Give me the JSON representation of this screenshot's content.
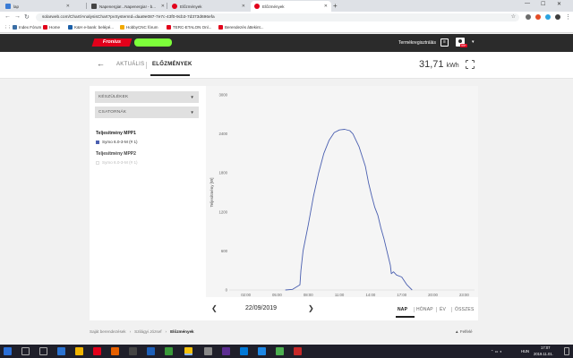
{
  "browser": {
    "tabs": [
      {
        "label": "lap",
        "color": "#3a7bd5"
      },
      {
        "label": "Napenergia!...Napenergia! - b...",
        "color": "#444444"
      },
      {
        "label": "Előzmények",
        "color": "#e2001a"
      },
      {
        "label": "Előzmények",
        "color": "#e2001a"
      }
    ],
    "new_tab": "+",
    "url": "solarweb.com/Chart/AnalysisChart?pvSystemId=daa9e087-7e7c-43f0-9cb3-7d373d696efa",
    "bookmarks": [
      {
        "label": "Index Fórum",
        "color": "#3a6ea5"
      },
      {
        "label": "Home",
        "color": "#e2001a"
      },
      {
        "label": "K&H e-bank: belépé...",
        "color": "#1a5fa8"
      },
      {
        "label": "HobbyCNC fórum",
        "color": "#f2a900"
      },
      {
        "label": "TERC-ETALON Onl...",
        "color": "#e2001a"
      },
      {
        "label": "Berendezés áttekint...",
        "color": "#e2001a"
      }
    ]
  },
  "header": {
    "logo_text": "Fronius",
    "product_registration": "Termékregisztrálás",
    "badge": "99+"
  },
  "subheader": {
    "tabs": [
      {
        "label": "AKTUÁLIS",
        "active": false
      },
      {
        "label": "ELŐZMÉNYEK",
        "active": true
      }
    ],
    "energy_value": "31,71",
    "energy_unit": "kWh"
  },
  "sidebar": {
    "devices_label": "KÉSZÜLÉKEK",
    "channels_label": "CSATORNÁK",
    "groups": [
      {
        "title": "Teljesítmény MPP1",
        "item": "Symo 6.0-3-M (# 1)",
        "color": "#4a5fb0",
        "enabled": true
      },
      {
        "title": "Teljesítmény MPP2",
        "item": "Symo 6.0-3-M (# 1)",
        "color": "#dddddd",
        "enabled": false
      }
    ]
  },
  "chart_data": {
    "type": "line",
    "ylabel": "Teljesítmény [W]",
    "xlabel": "",
    "x_ticks": [
      "02:00",
      "05:00",
      "08:00",
      "11:00",
      "14:00",
      "17:00",
      "20:00",
      "23:00"
    ],
    "y_ticks": [
      "0",
      "600",
      "1200",
      "1800",
      "2400",
      "3000"
    ],
    "ylim": [
      0,
      3000
    ],
    "xlim_hours": [
      0,
      24
    ],
    "grid": false,
    "legend": "none",
    "series": [
      {
        "name": "Teljesítmény MPP1",
        "color": "#4a5fb0",
        "x": [
          5.8,
          6.5,
          7.2,
          7.3,
          7.5,
          8.0,
          8.5,
          9.0,
          9.5,
          10.0,
          10.5,
          11.0,
          11.5,
          12.0,
          12.3,
          12.6,
          12.9,
          13.2,
          13.5,
          13.8,
          14.1,
          14.4,
          14.7,
          15.0,
          15.3,
          15.6,
          15.9,
          16.0,
          16.2,
          16.5,
          17.0,
          17.5,
          18.0
        ],
        "y": [
          0,
          10,
          80,
          300,
          600,
          1000,
          1440,
          1800,
          2100,
          2300,
          2420,
          2460,
          2470,
          2450,
          2400,
          2300,
          2200,
          2050,
          1900,
          1650,
          1450,
          1270,
          1150,
          950,
          780,
          580,
          380,
          250,
          280,
          230,
          200,
          80,
          0
        ]
      }
    ]
  },
  "datenav": {
    "date": "22/09/2019",
    "periods": [
      {
        "label": "NAP",
        "active": true
      },
      {
        "label": "HÓNAP",
        "active": false
      },
      {
        "label": "ÉV",
        "active": false
      },
      {
        "label": "ÖSSZES",
        "active": false
      }
    ]
  },
  "breadcrumbs": [
    "Saját berendezések",
    "Szilágyi József",
    "Előzmények"
  ],
  "up_label": "Felfelé",
  "taskbar": {
    "lang": "HUN",
    "time": "17:07",
    "date": "2019.11.01."
  }
}
